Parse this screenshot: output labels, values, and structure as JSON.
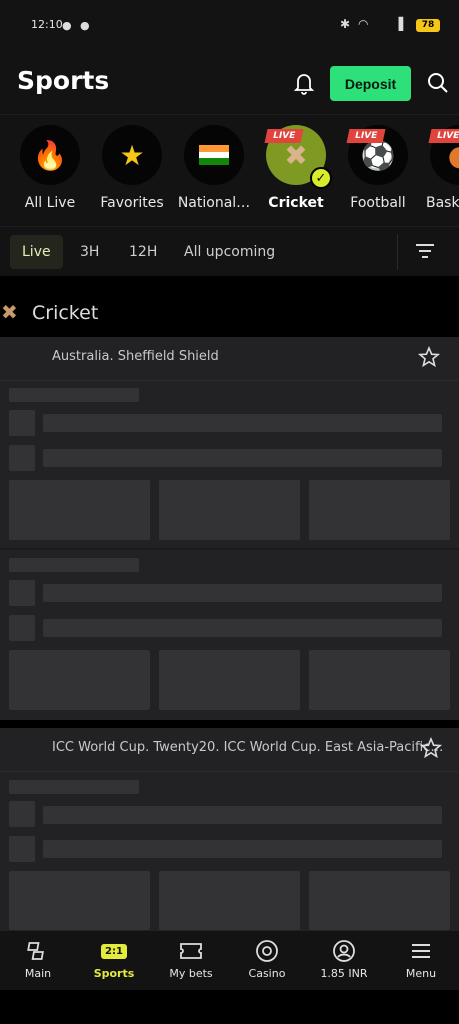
{
  "status": {
    "time": "12:10",
    "battery": "78"
  },
  "header": {
    "title": "Sports",
    "deposit_label": "Deposit"
  },
  "categories": [
    {
      "label": "All Live",
      "icon": "fire-icon"
    },
    {
      "label": "Favorites",
      "icon": "star-icon"
    },
    {
      "label": "National…",
      "icon": "india-flag-icon"
    },
    {
      "label": "Cricket",
      "icon": "cricket-icon",
      "live": "LIVE",
      "active": true
    },
    {
      "label": "Football",
      "icon": "football-icon",
      "live": "LIVE"
    },
    {
      "label": "Bask",
      "icon": "basketball-icon",
      "live": "LIVE"
    }
  ],
  "filters": {
    "tabs": [
      "Live",
      "3H",
      "12H",
      "All upcoming"
    ],
    "active": "Live"
  },
  "section": {
    "title": "Cricket"
  },
  "cards": [
    {
      "league": "Australia. Sheffield Shield"
    },
    {
      "league": "ICC World Cup. Twenty20. ICC World Cup. East Asia-Pacific…"
    }
  ],
  "bottom_nav": [
    {
      "label": "Main",
      "icon": "main-icon"
    },
    {
      "label": "Sports",
      "icon": "sports-icon",
      "badge": "2:1",
      "active": true
    },
    {
      "label": "My bets",
      "icon": "ticket-icon"
    },
    {
      "label": "Casino",
      "icon": "casino-chip-icon"
    },
    {
      "label": "1.85 INR",
      "icon": "account-icon"
    },
    {
      "label": "Menu",
      "icon": "menu-icon"
    }
  ],
  "colors": {
    "accent_green": "#2ee07a",
    "accent_yellow": "#e3ec3a",
    "live_red": "#e0443c",
    "background": "#000000",
    "surface": "#222224"
  }
}
